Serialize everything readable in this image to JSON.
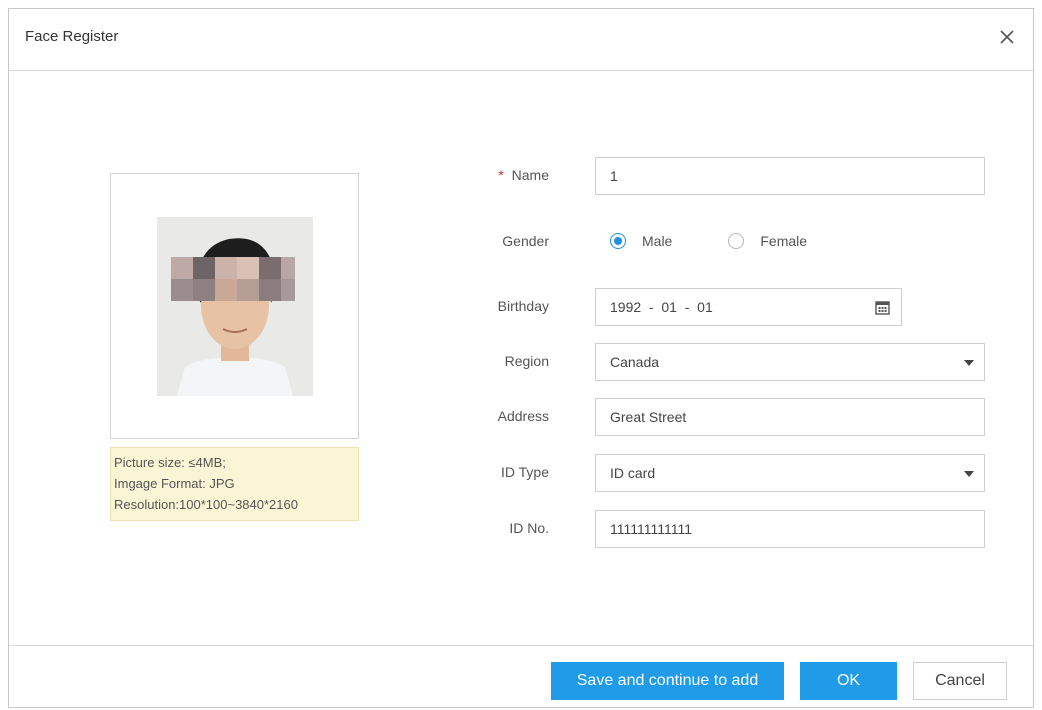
{
  "dialog": {
    "title": "Face Register"
  },
  "photo": {
    "hint_lines": [
      "Picture size: ≤4MB;",
      "Imgage Format: JPG",
      "Resolution:100*100~3840*2160"
    ]
  },
  "form": {
    "name": {
      "label": "Name",
      "required_mark": "*",
      "value": "1"
    },
    "gender": {
      "label": "Gender",
      "options": [
        {
          "label": "Male",
          "checked": true
        },
        {
          "label": "Female",
          "checked": false
        }
      ]
    },
    "birthday": {
      "label": "Birthday",
      "value": "1992  -  01  -  01"
    },
    "region": {
      "label": "Region",
      "value": "Canada"
    },
    "address": {
      "label": "Address",
      "value": "Great Street"
    },
    "id_type": {
      "label": "ID Type",
      "value": "ID card"
    },
    "id_no": {
      "label": "ID No.",
      "value": "111111111111"
    }
  },
  "footer": {
    "save_continue_label": "Save and continue to add",
    "ok_label": "OK",
    "cancel_label": "Cancel"
  },
  "colors": {
    "accent": "#1f9be8",
    "required": "#e22b2b",
    "hint_bg": "#fbf5d6"
  },
  "icons": {
    "close": "close-icon",
    "calendar": "calendar-icon",
    "dropdown": "chevron-down-icon"
  }
}
